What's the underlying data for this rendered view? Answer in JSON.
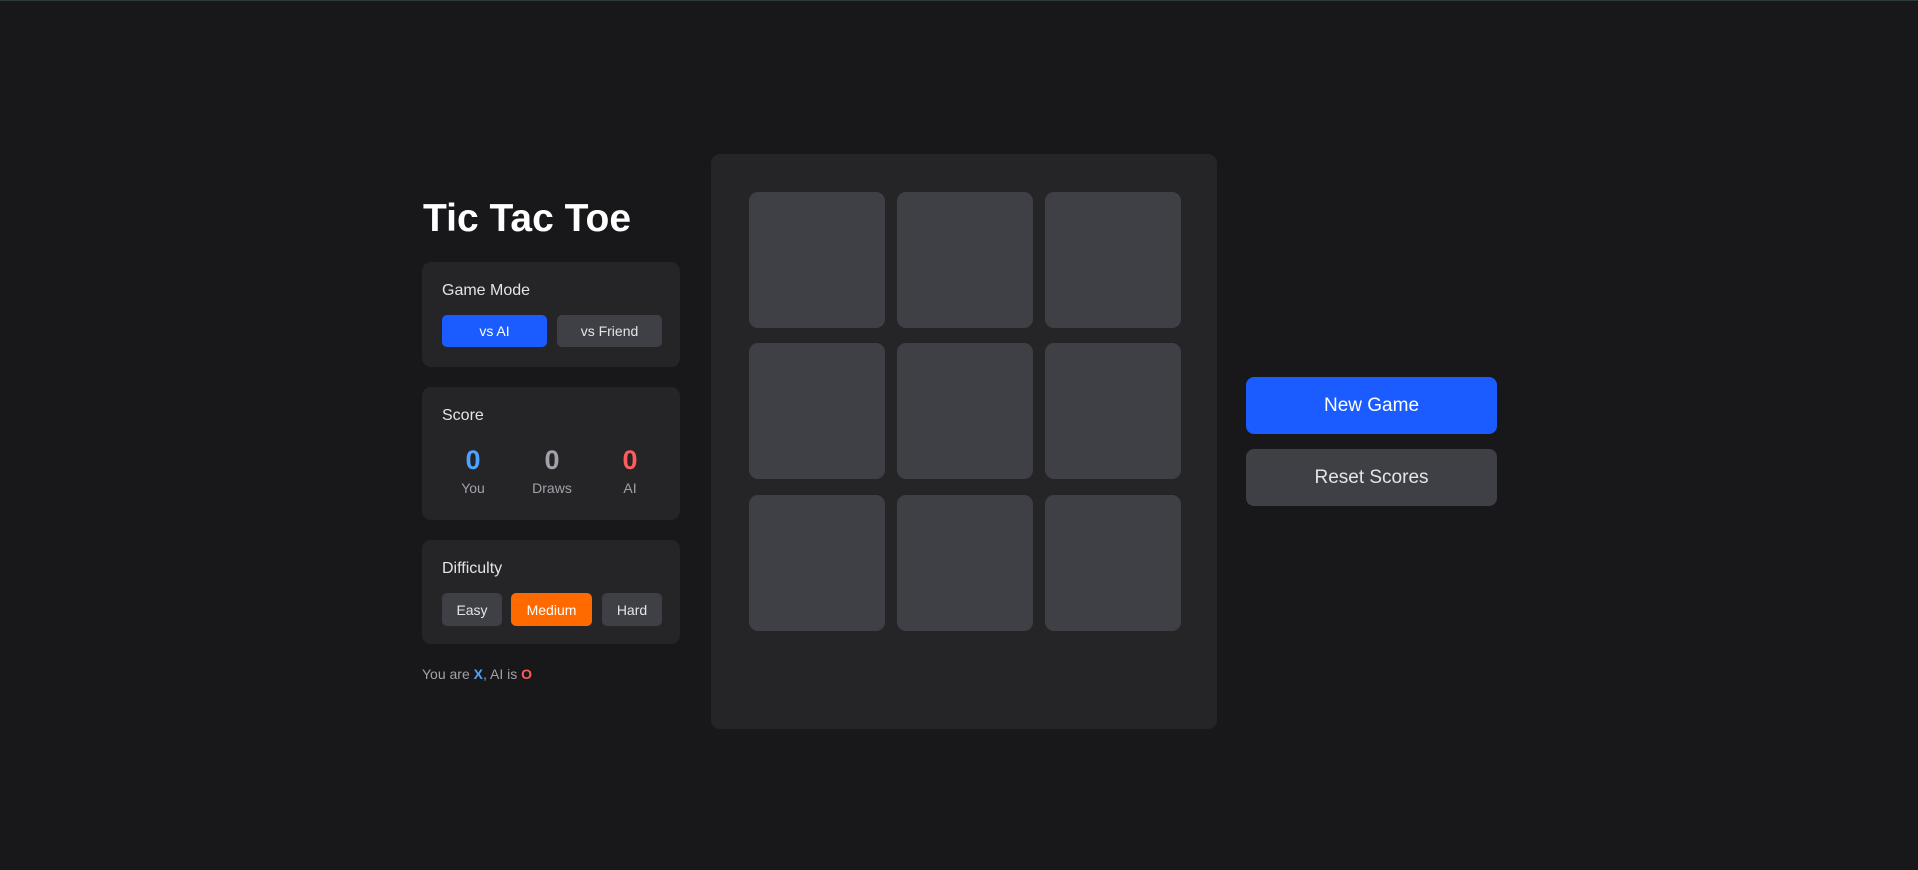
{
  "title": "Tic Tac Toe",
  "game_mode": {
    "label": "Game Mode",
    "options": [
      "vs AI",
      "vs Friend"
    ],
    "selected": "vs AI"
  },
  "score": {
    "label": "Score",
    "you": {
      "value": "0",
      "label": "You"
    },
    "draws": {
      "value": "0",
      "label": "Draws"
    },
    "ai": {
      "value": "0",
      "label": "AI"
    }
  },
  "difficulty": {
    "label": "Difficulty",
    "options": [
      "Easy",
      "Medium",
      "Hard"
    ],
    "selected": "Medium"
  },
  "footer": {
    "prefix": "You are ",
    "player_mark": "X",
    "middle": ", AI is ",
    "ai_mark": "O"
  },
  "board": {
    "cells": [
      "",
      "",
      "",
      "",
      "",
      "",
      "",
      "",
      ""
    ]
  },
  "actions": {
    "new_game": "New Game",
    "reset_scores": "Reset Scores"
  },
  "colors": {
    "accent_blue": "#1a5cff",
    "accent_orange": "#ff6a00",
    "player_x": "#4da3ff",
    "ai_o": "#ff5c5c",
    "draws": "#a1a1aa"
  }
}
